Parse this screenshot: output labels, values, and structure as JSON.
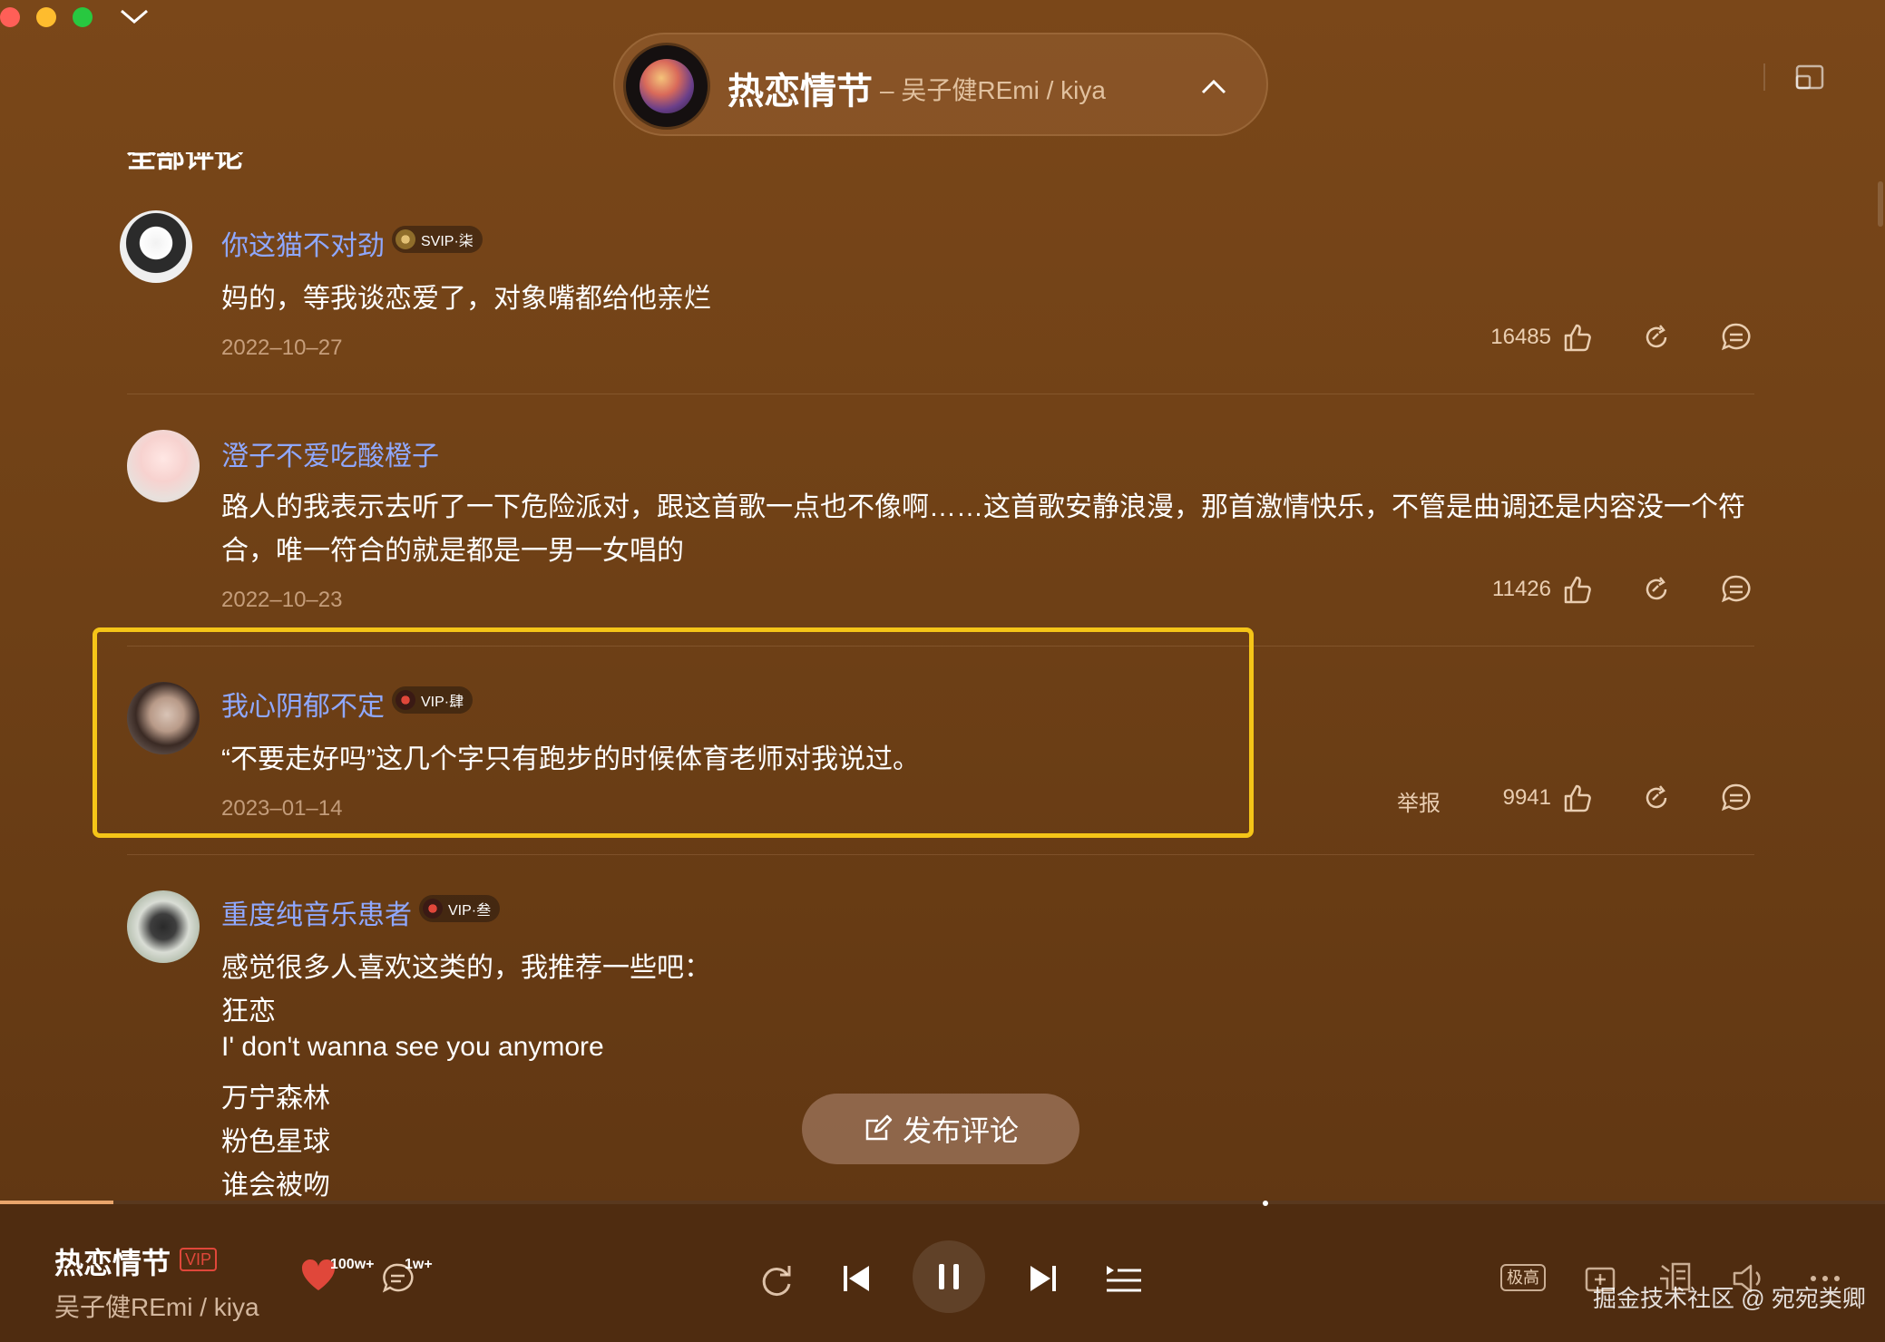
{
  "window": {
    "controls": [
      "close",
      "minimize",
      "maximize"
    ]
  },
  "header": {
    "song_title": "热恋情节",
    "song_subtitle": "– 吴子健REmi / kiya"
  },
  "section_title": "全部评论",
  "comments": [
    {
      "username": "你这猫不对劲",
      "badge": "SVIP·柒",
      "text": "妈的，等我谈恋爱了，对象嘴都给他亲烂",
      "date": "2022–10–27",
      "likes": "16485"
    },
    {
      "username": "澄子不爱吃酸橙子",
      "text_line1": "路人的我表示去听了一下危险派对，跟这首歌一点也不像啊……这首歌安静浪漫，那首激情快乐，不管是曲调还是内容没一个符",
      "text_line2": "合，唯一符合的就是都是一男一女唱的",
      "date": "2022–10–23",
      "likes": "11426"
    },
    {
      "username": "我心阴郁不定",
      "badge": "VIP·肆",
      "text": "“不要走好吗”这几个字只有跑步的时候体育老师对我说过。",
      "date": "2023–01–14",
      "report": "举报",
      "likes": "9941"
    },
    {
      "username": "重度纯音乐患者",
      "badge": "VIP·叁",
      "lines": [
        "感觉很多人喜欢这类的，我推荐一些吧：",
        "狂恋",
        "I' don't wanna see you anymore",
        "万宁森林",
        "粉色星球",
        "谁会被吻"
      ]
    }
  ],
  "publish_button": "发布评论",
  "player": {
    "title": "热恋情节",
    "vip": "VIP",
    "artist": "吴子健REmi / kiya",
    "like_count": "100w+",
    "comment_count": "1w+",
    "progress": 0.06,
    "quality": "极高"
  },
  "watermark": "掘金技术社区 @ 宛宛类卿",
  "colors": {
    "username": "#8fa8ff",
    "highlight": "#f5c518",
    "heart": "#e0473a"
  }
}
